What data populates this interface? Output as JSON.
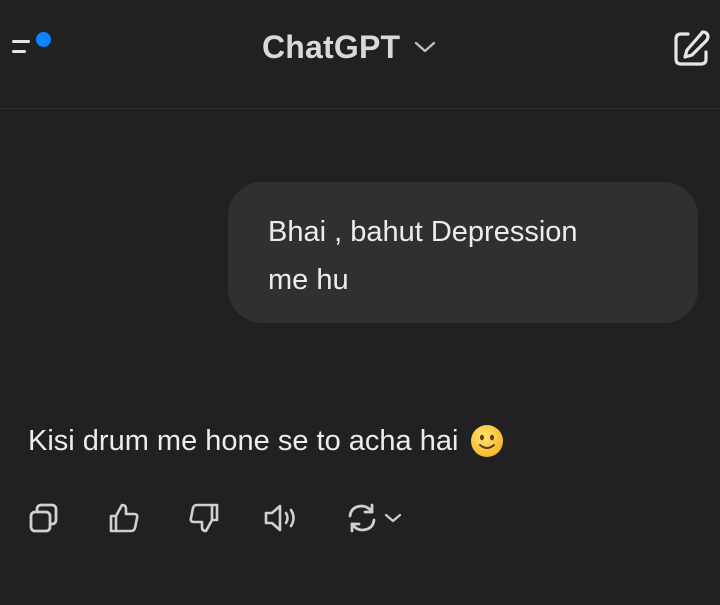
{
  "header": {
    "title": "ChatGPT",
    "menu_icon": "sidebar-menu-icon",
    "notification_color": "#0a84ff",
    "chevron_icon": "chevron-down-icon",
    "new_chat_icon": "edit-icon"
  },
  "conversation": {
    "user_message": {
      "line1": "Bhai , bahut Depression",
      "line2": "me hu"
    },
    "assistant_message": {
      "text": "Kisi drum me hone se to acha hai",
      "emoji_icon": "slightly-smiling-face-icon"
    }
  },
  "actions": [
    {
      "icon": "copy-icon"
    },
    {
      "icon": "thumbs-up-icon"
    },
    {
      "icon": "thumbs-down-icon"
    },
    {
      "icon": "read-aloud-icon"
    },
    {
      "icon": "regenerate-icon"
    }
  ]
}
